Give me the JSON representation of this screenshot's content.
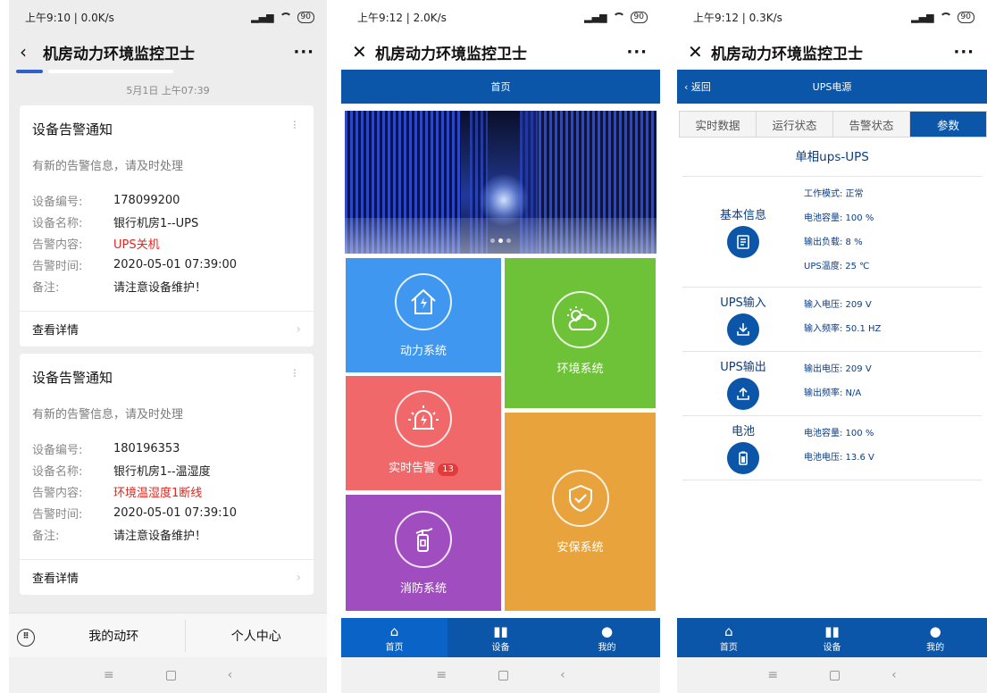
{
  "panel1": {
    "status": {
      "time": "上午9:10 | 0.0K/s",
      "signal": "⁵⁶ıl",
      "battery": "90"
    },
    "title": "机房动力环境监控卫士",
    "timestamp": "5月1日 上午07:39",
    "cards": [
      {
        "title": "设备告警通知",
        "subtitle": "有新的告警信息，请及时处理",
        "rows": [
          {
            "key": "设备编号:",
            "value": "178099200"
          },
          {
            "key": "设备名称:",
            "value": "银行机房1--UPS"
          },
          {
            "key": "告警内容:",
            "value": "UPS关机"
          },
          {
            "key": "告警时间:",
            "value": "2020-05-01 07:39:00"
          },
          {
            "key": "备注:",
            "value": "请注意设备维护！"
          }
        ],
        "footer": "查看详情"
      },
      {
        "title": "设备告警通知",
        "subtitle": "有新的告警信息，请及时处理",
        "rows": [
          {
            "key": "设备编号:",
            "value": "180196353"
          },
          {
            "key": "设备名称:",
            "value": "银行机房1--温湿度"
          },
          {
            "key": "告警内容:",
            "value": "环境温湿度1断线"
          },
          {
            "key": "告警时间:",
            "value": "2020-05-01 07:39:10"
          },
          {
            "key": "备注:",
            "value": "请注意设备维护！"
          }
        ],
        "footer": "查看详情"
      }
    ],
    "bottom_menu": [
      "我的动环",
      "个人中心"
    ]
  },
  "panel2": {
    "status": {
      "time": "上午9:12 | 2.0K/s",
      "battery": "90"
    },
    "title": "机房动力环境监控卫士",
    "header": "首页",
    "tiles": [
      {
        "label": "动力系统",
        "color": "#3f97f0"
      },
      {
        "label": "环境系统",
        "color": "#6dc238"
      },
      {
        "label": "实时告警",
        "badge": "13",
        "color": "#f0686a"
      },
      {
        "label": "安保系统",
        "color": "#e8a33c"
      },
      {
        "label": "消防系统",
        "color": "#a04ebf"
      }
    ],
    "tabs": [
      "首页",
      "设备",
      "我的"
    ]
  },
  "panel3": {
    "status": {
      "time": "上午9:12 | 0.3K/s",
      "battery": "90"
    },
    "title": "机房动力环境监控卫士",
    "back": "返回",
    "header": "UPS电源",
    "segments": [
      "实时数据",
      "运行状态",
      "告警状态",
      "参数"
    ],
    "device": "单相ups-UPS",
    "sections": [
      {
        "name": "基本信息",
        "icon": "doc-icon",
        "params": [
          "工作模式: 正常",
          "电池容量: 100 %",
          "输出负载: 8 %",
          "UPS温度: 25 ℃"
        ]
      },
      {
        "name": "UPS输入",
        "icon": "download-icon",
        "params": [
          "输入电压: 209 V",
          "输入频率: 50.1 HZ"
        ]
      },
      {
        "name": "UPS输出",
        "icon": "upload-icon",
        "params": [
          "输出电压: 209 V",
          "输出频率: N/A"
        ]
      },
      {
        "name": "电池",
        "icon": "battery-icon",
        "params": [
          "电池容量: 100 %",
          "电池电压: 13.6 V"
        ]
      }
    ],
    "tabs": [
      "首页",
      "设备",
      "我的"
    ]
  }
}
